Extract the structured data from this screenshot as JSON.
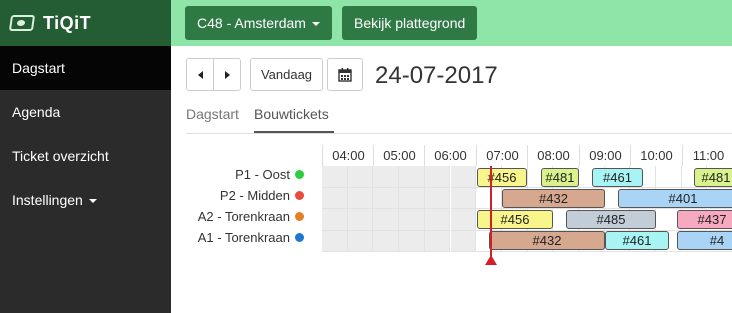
{
  "brand": {
    "name": "TiQiT"
  },
  "sidebar": {
    "items": [
      {
        "label": "Dagstart",
        "active": true
      },
      {
        "label": "Agenda",
        "active": false
      },
      {
        "label": "Ticket overzicht",
        "active": false
      },
      {
        "label": "Instellingen",
        "active": false,
        "dropdown": true
      }
    ]
  },
  "topbar": {
    "location_label": "C48 - Amsterdam",
    "map_button_label": "Bekijk plattegrond"
  },
  "toolbar": {
    "today_label": "Vandaag",
    "calendar_icon": "calendar-icon",
    "date": "24-07-2017"
  },
  "tabs": [
    {
      "label": "Dagstart",
      "active": false
    },
    {
      "label": "Bouwtickets",
      "active": true
    }
  ],
  "schedule": {
    "hours": [
      "04:00",
      "05:00",
      "06:00",
      "07:00",
      "08:00",
      "09:00",
      "10:00",
      "11:00"
    ],
    "rows": [
      {
        "label": "P1 - Oost",
        "dot_color": "#2ecc40"
      },
      {
        "label": "P2 - Midden",
        "dot_color": "#e74c3c"
      },
      {
        "label": "A2 - Torenkraan",
        "dot_color": "#e67e22"
      },
      {
        "label": "A1 - Torenkraan",
        "dot_color": "#1f77d0"
      }
    ],
    "tickets": [
      {
        "row": 0,
        "label": "#456",
        "color": "#f8f58a"
      },
      {
        "row": 0,
        "label": "#481",
        "color": "#d9f28c"
      },
      {
        "row": 0,
        "label": "#461",
        "color": "#a8f4f4"
      },
      {
        "row": 0,
        "label": "#481",
        "color": "#d9f28c"
      },
      {
        "row": 1,
        "label": "#432",
        "color": "#d6a890"
      },
      {
        "row": 1,
        "label": "#401",
        "color": "#a9d4f5"
      },
      {
        "row": 2,
        "label": "#456",
        "color": "#f8f58a"
      },
      {
        "row": 2,
        "label": "#485",
        "color": "#c2cdd8"
      },
      {
        "row": 2,
        "label": "#437",
        "color": "#f7a9c0"
      },
      {
        "row": 3,
        "label": "#432",
        "color": "#d6a890"
      },
      {
        "row": 3,
        "label": "#461",
        "color": "#a8f4f4"
      },
      {
        "row": 3,
        "label": "#4",
        "color": "#a9d4f5"
      }
    ],
    "current_time_color": "#d0202a"
  }
}
